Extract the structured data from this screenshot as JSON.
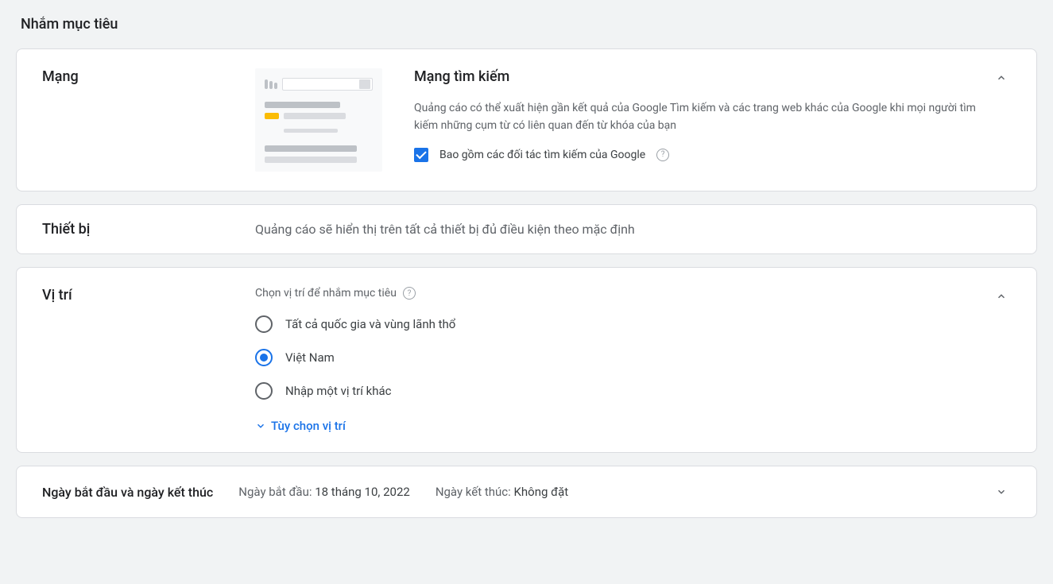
{
  "section_title": "Nhắm mục tiêu",
  "networks": {
    "label": "Mạng",
    "title": "Mạng tìm kiếm",
    "description": "Quảng cáo có thể xuất hiện gần kết quả của Google Tìm kiếm và các trang web khác của Google khi mọi người tìm kiếm những cụm từ có liên quan đến từ khóa của bạn",
    "checkbox_label": "Bao gồm các đối tác tìm kiếm của Google",
    "checkbox_checked": true
  },
  "devices": {
    "label": "Thiết bị",
    "summary": "Quảng cáo sẽ hiển thị trên tất cả thiết bị đủ điều kiện theo mặc định"
  },
  "locations": {
    "label": "Vị trí",
    "subtitle": "Chọn vị trí để nhắm mục tiêu",
    "options": [
      {
        "label": "Tất cả quốc gia và vùng lãnh thổ",
        "selected": false
      },
      {
        "label": "Việt Nam",
        "selected": true
      },
      {
        "label": "Nhập một vị trí khác",
        "selected": false
      }
    ],
    "expand_link": "Tùy chọn vị trí"
  },
  "dates": {
    "label": "Ngày bắt đầu và ngày kết thúc",
    "start_key": "Ngày bắt đầu: ",
    "start_value": "18 tháng 10, 2022",
    "end_key": "Ngày kết thúc: ",
    "end_value": "Không đặt"
  }
}
